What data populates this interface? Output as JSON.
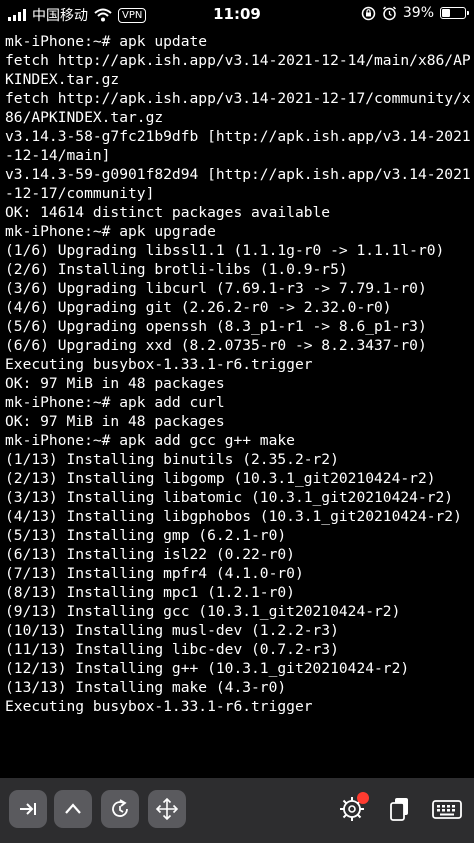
{
  "status_bar": {
    "carrier": "中国移动",
    "vpn_badge": "VPN",
    "time": "11:09",
    "battery_percent": "39%",
    "battery_level": 0.39,
    "icons": [
      "signal-icon",
      "wifi-icon",
      "orientation-lock-icon",
      "alarm-icon",
      "battery-icon"
    ]
  },
  "terminal": {
    "lines": [
      "mk-iPhone:~# apk update",
      "fetch http://apk.ish.app/v3.14-2021-12-14/main/x86/APKINDEX.tar.gz",
      "fetch http://apk.ish.app/v3.14-2021-12-17/community/x86/APKINDEX.tar.gz",
      "v3.14.3-58-g7fc21b9dfb [http://apk.ish.app/v3.14-2021-12-14/main]",
      "v3.14.3-59-g0901f82d94 [http://apk.ish.app/v3.14-2021-12-17/community]",
      "OK: 14614 distinct packages available",
      "mk-iPhone:~# apk upgrade",
      "(1/6) Upgrading libssl1.1 (1.1.1g-r0 -> 1.1.1l-r0)",
      "(2/6) Installing brotli-libs (1.0.9-r5)",
      "(3/6) Upgrading libcurl (7.69.1-r3 -> 7.79.1-r0)",
      "(4/6) Upgrading git (2.26.2-r0 -> 2.32.0-r0)",
      "(5/6) Upgrading openssh (8.3_p1-r1 -> 8.6_p1-r3)",
      "(6/6) Upgrading xxd (8.2.0735-r0 -> 8.2.3437-r0)",
      "Executing busybox-1.33.1-r6.trigger",
      "OK: 97 MiB in 48 packages",
      "mk-iPhone:~# apk add curl",
      "OK: 97 MiB in 48 packages",
      "mk-iPhone:~# apk add gcc g++ make",
      "(1/13) Installing binutils (2.35.2-r2)",
      "(2/13) Installing libgomp (10.3.1_git20210424-r2)",
      "(3/13) Installing libatomic (10.3.1_git20210424-r2)",
      "(4/13) Installing libgphobos (10.3.1_git20210424-r2)",
      "(5/13) Installing gmp (6.2.1-r0)",
      "(6/13) Installing isl22 (0.22-r0)",
      "(7/13) Installing mpfr4 (4.1.0-r0)",
      "(8/13) Installing mpc1 (1.2.1-r0)",
      "(9/13) Installing gcc (10.3.1_git20210424-r2)",
      "(10/13) Installing musl-dev (1.2.2-r3)",
      "(11/13) Installing libc-dev (0.7.2-r3)",
      "(12/13) Installing g++ (10.3.1_git20210424-r2)",
      "(13/13) Installing make (4.3-r0)",
      "Executing busybox-1.33.1-r6.trigger"
    ]
  },
  "toolbar": {
    "left_buttons": [
      "tab-key-icon",
      "up-arrow-icon",
      "hide-keyboard-icon",
      "move-arrows-icon"
    ],
    "right_buttons": [
      "settings-gear-icon",
      "paste-icon",
      "keyboard-icon"
    ],
    "settings_badge_color": "#ff3b30"
  },
  "colors": {
    "background": "#000000",
    "text": "#ffffff",
    "toolbar_bg": "#2d2d2f",
    "button_bg": "#5a5a5e"
  }
}
